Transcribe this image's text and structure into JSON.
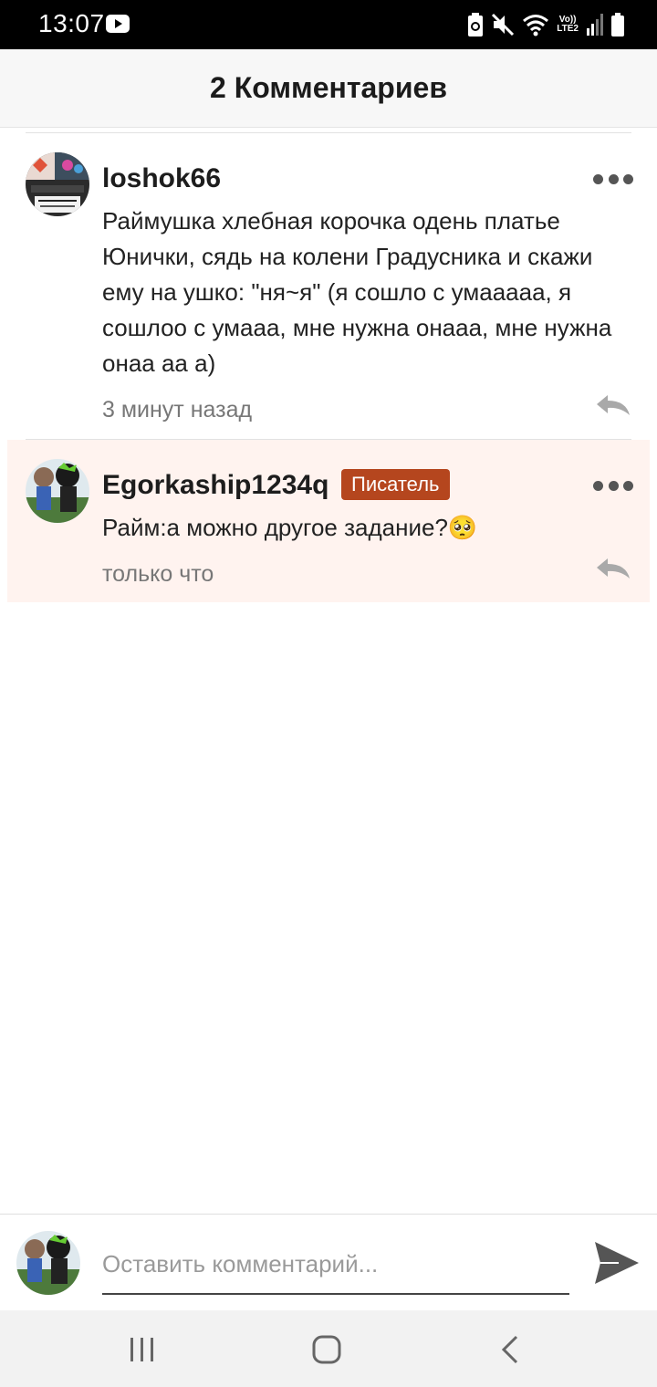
{
  "status_bar": {
    "time": "13:07",
    "icons": [
      "youtube-icon",
      "battery-saver-icon",
      "mute-icon",
      "wifi-icon",
      "volte-lte2-icon",
      "signal-icon",
      "battery-icon"
    ],
    "volte": "Vo))",
    "lte": "LTE2"
  },
  "header": {
    "title": "2 Комментариев"
  },
  "comments": [
    {
      "author": "loshok66",
      "text": "Раймушка хлебная корочка одень платье Юнички, сядь на колени Градусника и скажи ему на ушко: \"ня~я\" (я сошло с умааааа, я сошлоо с умааа, мне нужна онааа, мне нужна онаа аа а)",
      "time": "3 минут назад",
      "highlighted": false
    },
    {
      "author": "Egorkaship1234q",
      "badge": "Писатель",
      "text": "Райм:а можно другое задание?🥺",
      "time": "только что",
      "highlighted": true
    }
  ],
  "composer": {
    "placeholder": "Оставить комментарий..."
  },
  "nav": {
    "icons": [
      "recent-apps-icon",
      "home-icon",
      "back-icon"
    ]
  },
  "colors": {
    "badge": "#b5461e",
    "highlight": "#fff3ef",
    "header_bg": "#f7f7f7"
  }
}
